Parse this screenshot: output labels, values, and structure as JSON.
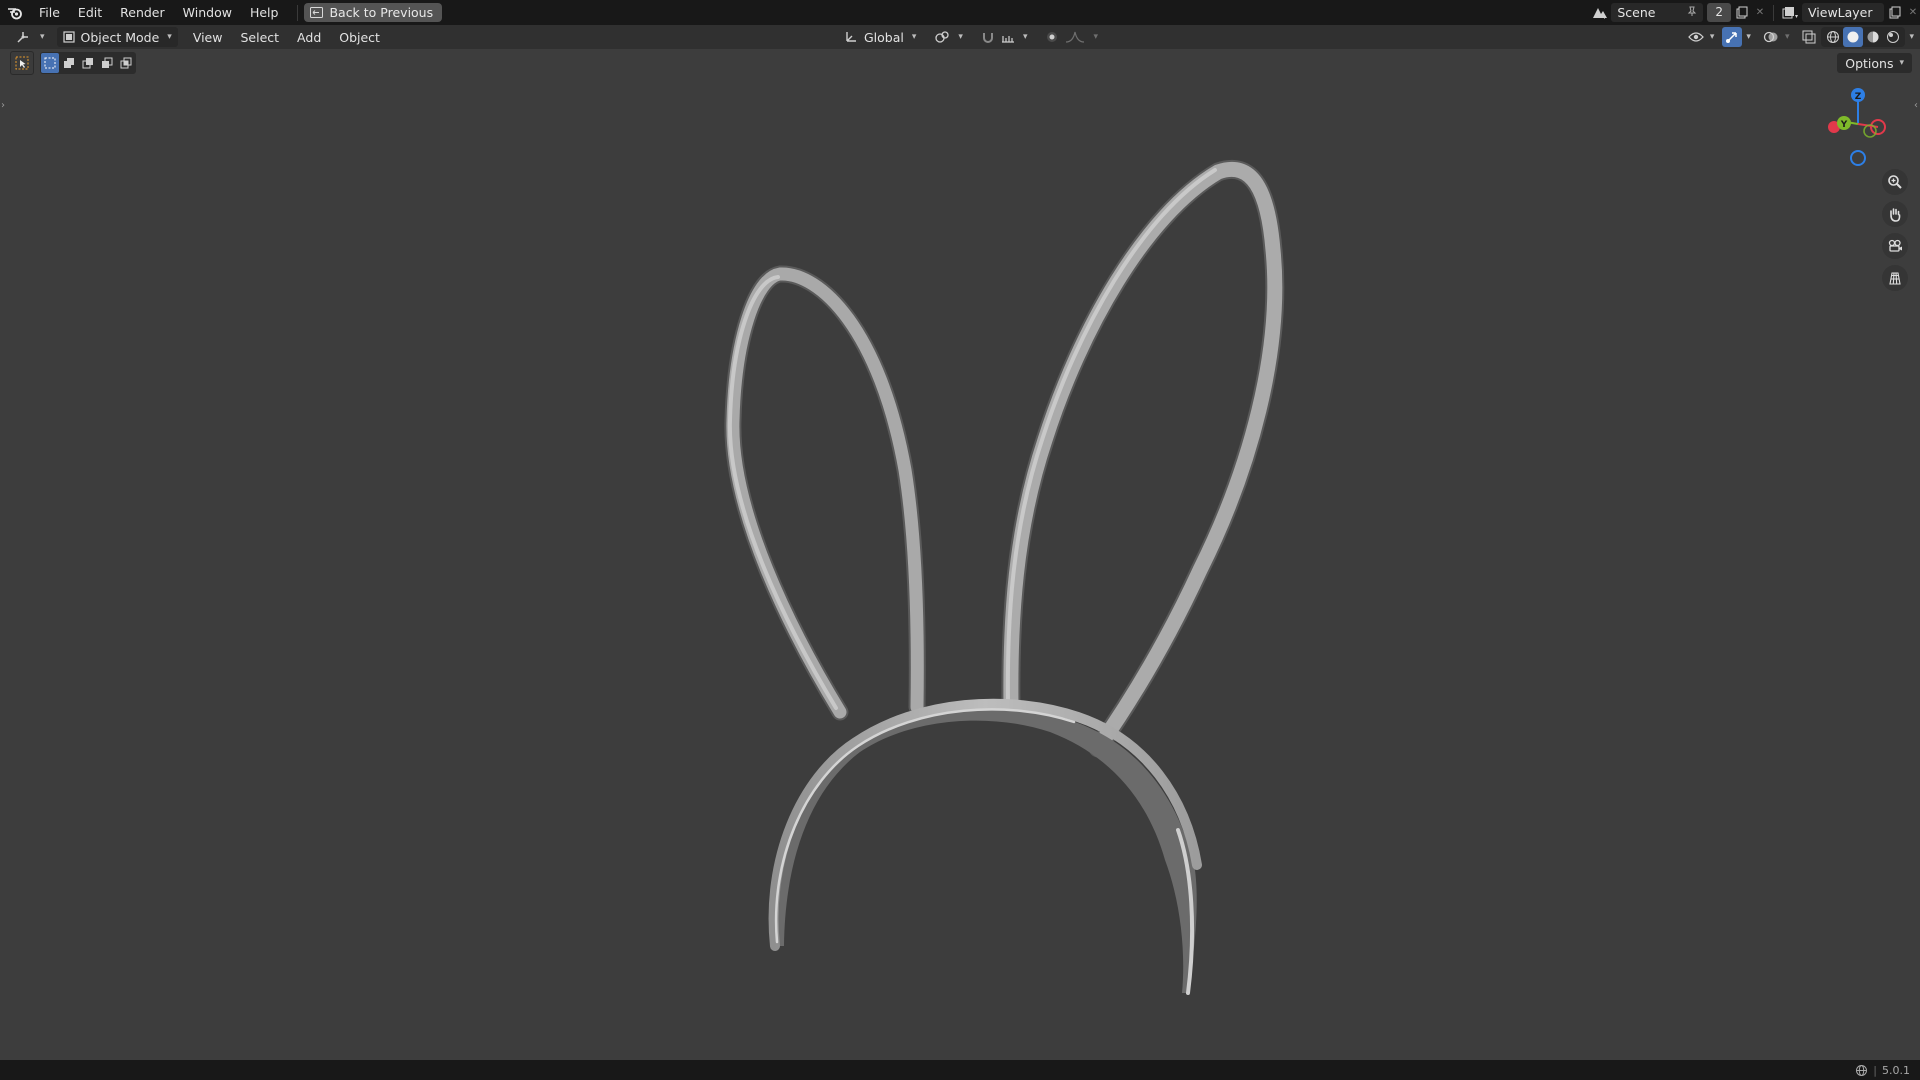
{
  "topbar": {
    "menus": [
      "File",
      "Edit",
      "Render",
      "Window",
      "Help"
    ],
    "back_button": "Back to Previous",
    "scene_name": "Scene",
    "scene_count": "2",
    "view_layer": "ViewLayer"
  },
  "header": {
    "mode": "Object Mode",
    "menus": [
      "View",
      "Select",
      "Add",
      "Object"
    ],
    "orientation": "Global",
    "options_label": "Options"
  },
  "gizmo": {
    "z_label": "Z",
    "y_label": "Y",
    "colors": {
      "x": "#e2394b",
      "y": "#7fba2a",
      "z": "#2d7fe6"
    }
  },
  "status": {
    "version": "5.0.1"
  },
  "accent_color": "#4772b3"
}
